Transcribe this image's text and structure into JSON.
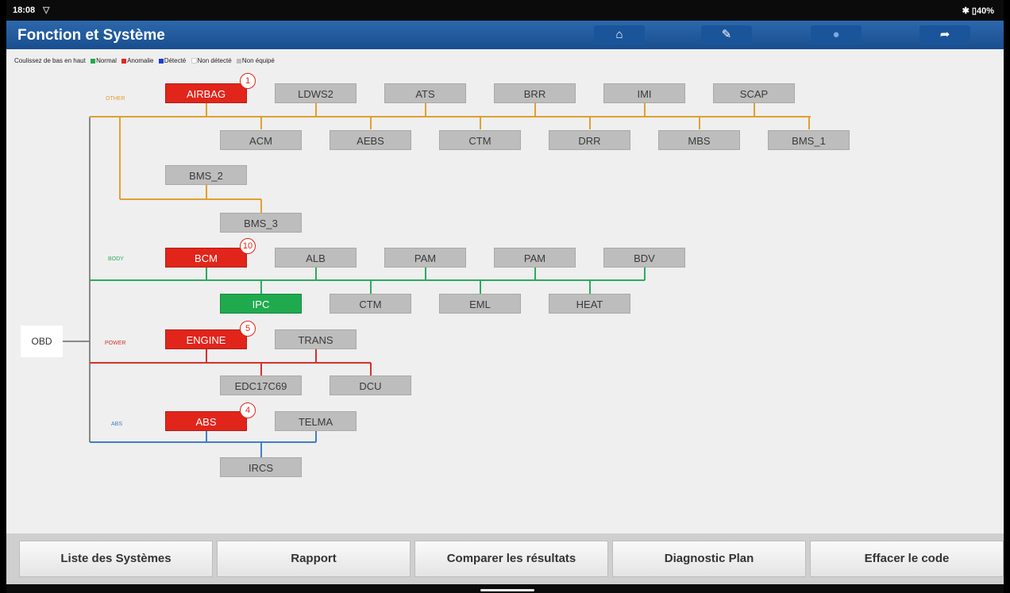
{
  "status": {
    "time": "18:08",
    "right": "✱ ▯40%"
  },
  "header": {
    "title": "Fonction et Système"
  },
  "toolbar": [
    {
      "name": "home-button",
      "icon": "home-icon",
      "glyph": "⌂"
    },
    {
      "name": "edit-button",
      "icon": "edit-icon",
      "glyph": "✎"
    },
    {
      "name": "print-button",
      "icon": "print-icon",
      "glyph": "●"
    },
    {
      "name": "exit-button",
      "icon": "exit-icon",
      "glyph": "➦"
    }
  ],
  "legend": {
    "intro": "Coulissez de bas en haut",
    "items": [
      {
        "label": "Normal",
        "color": "#20aa4e"
      },
      {
        "label": "Anomalie",
        "color": "#e1251b"
      },
      {
        "label": "Détecté",
        "color": "#1f3ccc"
      },
      {
        "label": "Non détecté",
        "color": "#ffffff"
      },
      {
        "label": "Non équipé",
        "color": "#bdbdbd"
      }
    ]
  },
  "obd_label": "OBD",
  "groups": [
    {
      "label": "OTHER",
      "color": "#e0a030",
      "modules": [
        {
          "name": "AIRBAG",
          "status": "anomaly",
          "badge": "1"
        },
        {
          "name": "LDWS2",
          "status": "none"
        },
        {
          "name": "ATS",
          "status": "none"
        },
        {
          "name": "BRR",
          "status": "none"
        },
        {
          "name": "IMI",
          "status": "none"
        },
        {
          "name": "SCAP",
          "status": "none"
        },
        {
          "name": "ACM",
          "status": "none"
        },
        {
          "name": "AEBS",
          "status": "none"
        },
        {
          "name": "CTM",
          "status": "none"
        },
        {
          "name": "DRR",
          "status": "none"
        },
        {
          "name": "MBS",
          "status": "none"
        },
        {
          "name": "BMS_1",
          "status": "none"
        },
        {
          "name": "BMS_2",
          "status": "none"
        },
        {
          "name": "BMS_3",
          "status": "none"
        }
      ]
    },
    {
      "label": "BODY",
      "color": "#2eaa5e",
      "modules": [
        {
          "name": "BCM",
          "status": "anomaly",
          "badge": "10"
        },
        {
          "name": "ALB",
          "status": "none"
        },
        {
          "name": "PAM",
          "status": "none"
        },
        {
          "name": "PAM",
          "status": "none"
        },
        {
          "name": "BDV",
          "status": "none"
        },
        {
          "name": "IPC",
          "status": "normal"
        },
        {
          "name": "CTM",
          "status": "none"
        },
        {
          "name": "EML",
          "status": "none"
        },
        {
          "name": "HEAT",
          "status": "none"
        }
      ]
    },
    {
      "label": "POWER",
      "color": "#d53030",
      "modules": [
        {
          "name": "ENGINE",
          "status": "anomaly",
          "badge": "5"
        },
        {
          "name": "TRANS",
          "status": "none"
        },
        {
          "name": "EDC17C69",
          "status": "none"
        },
        {
          "name": "DCU",
          "status": "none"
        }
      ]
    },
    {
      "label": "ABS",
      "color": "#3f7fc9",
      "modules": [
        {
          "name": "ABS",
          "status": "anomaly",
          "badge": "4"
        },
        {
          "name": "TELMA",
          "status": "none"
        },
        {
          "name": "IRCS",
          "status": "none"
        }
      ]
    }
  ],
  "bottom_buttons": [
    {
      "label": "Liste des Systèmes"
    },
    {
      "label": "Rapport"
    },
    {
      "label": "Comparer les résultats"
    },
    {
      "label": "Diagnostic Plan"
    },
    {
      "label": "Effacer le code"
    }
  ]
}
